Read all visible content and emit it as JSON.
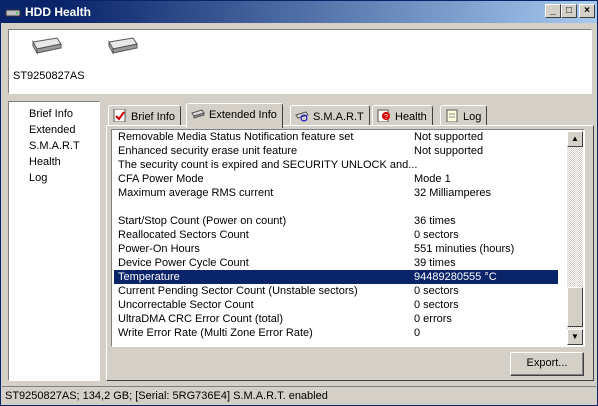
{
  "window": {
    "title": "HDD Health"
  },
  "devices": {
    "items": [
      {
        "label": "ST9250827AS"
      },
      {
        "label": ""
      }
    ]
  },
  "nav": {
    "items": [
      "Brief Info",
      "Extended",
      "S.M.A.R.T",
      "Health",
      "Log"
    ]
  },
  "tabs": [
    {
      "label": "Brief Info"
    },
    {
      "label": "Extended Info"
    },
    {
      "label": "S.M.A.R.T"
    },
    {
      "label": "Health"
    },
    {
      "label": "Log"
    }
  ],
  "extended_info": {
    "rows": [
      {
        "key": "Removable Media Status Notification feature set",
        "value": "Not supported"
      },
      {
        "key": "Enhanced security erase unit feature",
        "value": "Not supported"
      },
      {
        "key": "The security count is expired and SECURITY UNLOCK and...",
        "value": ""
      },
      {
        "key": "CFA Power Mode",
        "value": "Mode 1"
      },
      {
        "key": "Maximum average RMS current",
        "value": "32 Milliamperes"
      },
      {
        "key": "",
        "value": ""
      },
      {
        "key": "Start/Stop Count (Power on count)",
        "value": "36 times"
      },
      {
        "key": "Reallocated Sectors Count",
        "value": "0 sectors"
      },
      {
        "key": "Power-On Hours",
        "value": "551 minuties (hours)"
      },
      {
        "key": "Device Power Cycle Count",
        "value": "39 times"
      },
      {
        "key": "Temperature",
        "value": "94489280555 °C"
      },
      {
        "key": "Current Pending Sector Count (Unstable sectors)",
        "value": "0 sectors"
      },
      {
        "key": "Uncorrectable Sector Count",
        "value": "0 sectors"
      },
      {
        "key": "UltraDMA CRC Error Count (total)",
        "value": "0 errors"
      },
      {
        "key": "Write Error Rate (Multi Zone Error Rate)",
        "value": "0"
      }
    ],
    "selected_key": "Temperature"
  },
  "buttons": {
    "export": "Export..."
  },
  "status": {
    "text": "ST9250827AS;  134,2 GB;  [Serial: 5RG736E4]  S.M.A.R.T. enabled"
  },
  "colors": {
    "selection": "#0a246a",
    "titlebar": "#0a246a"
  }
}
